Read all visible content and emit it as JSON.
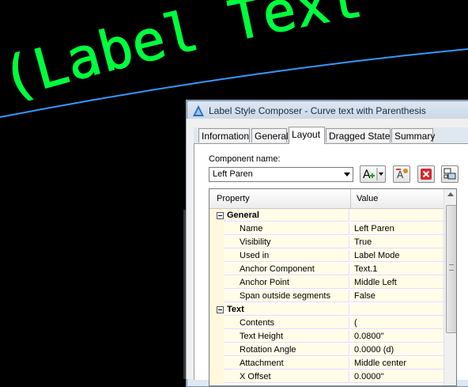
{
  "canvas": {
    "label_text": "(Label Text)",
    "label_color": "#00ff3c",
    "curve_color": "#3399ff"
  },
  "dialog": {
    "title": "Label Style Composer - Curve text with Parenthesis",
    "app_icon": "civil3d-app-icon",
    "tabs": [
      {
        "label": "Information",
        "active": false
      },
      {
        "label": "General",
        "active": false
      },
      {
        "label": "Layout",
        "active": true
      },
      {
        "label": "Dragged State",
        "active": false
      },
      {
        "label": "Summary",
        "active": false
      }
    ],
    "component_name_label": "Component name:",
    "component_name_value": "Left Paren",
    "toolbar": {
      "create_text_component": "create-text-component-icon",
      "copy_component": "copy-component-icon",
      "delete_component": "delete-component-icon",
      "component_draw_order": "draw-order-icon"
    },
    "grid": {
      "headers": {
        "property": "Property",
        "value": "Value"
      },
      "rows": [
        {
          "type": "category",
          "name": "General"
        },
        {
          "type": "property",
          "name": "Name",
          "value": "Left Paren"
        },
        {
          "type": "property",
          "name": "Visibility",
          "value": "True"
        },
        {
          "type": "property",
          "name": "Used in",
          "value": "Label Mode"
        },
        {
          "type": "property",
          "name": "Anchor Component",
          "value": "Text.1"
        },
        {
          "type": "property",
          "name": "Anchor Point",
          "value": "Middle Left"
        },
        {
          "type": "property",
          "name": "Span outside segments",
          "value": "False"
        },
        {
          "type": "category",
          "name": "Text"
        },
        {
          "type": "property",
          "name": "Contents",
          "value": "("
        },
        {
          "type": "property",
          "name": "Text Height",
          "value": "0.0800\""
        },
        {
          "type": "property",
          "name": "Rotation Angle",
          "value": "0.0000 (d)"
        },
        {
          "type": "property",
          "name": "Attachment",
          "value": "Middle center"
        },
        {
          "type": "property",
          "name": "X Offset",
          "value": "0.0000\""
        }
      ]
    }
  }
}
